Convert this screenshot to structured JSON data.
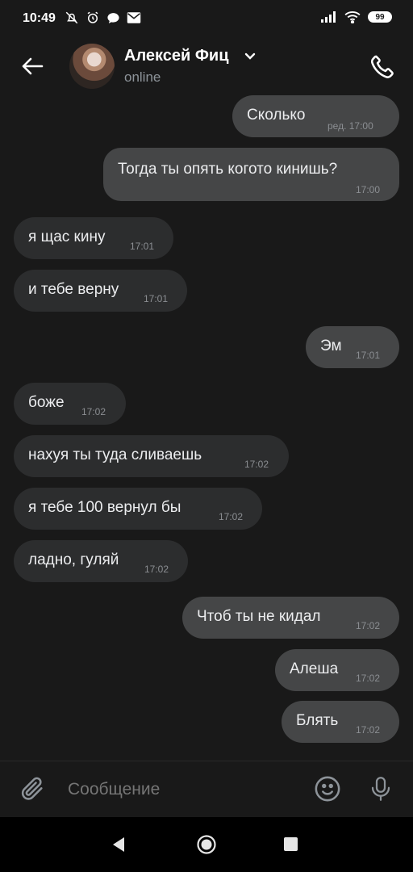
{
  "status": {
    "time": "10:49",
    "battery": "99"
  },
  "header": {
    "name": "Алексей Фиц",
    "status": "online"
  },
  "messages": [
    {
      "text": "Сколько",
      "time": "ред. 17:00",
      "dir": "out"
    },
    {
      "text": "Тогда ты опять когото кинишь?",
      "time": "17:00",
      "dir": "out"
    },
    {
      "text": "я щас кину",
      "time": "17:01",
      "dir": "in"
    },
    {
      "text": "и тебе верну",
      "time": "17:01",
      "dir": "in"
    },
    {
      "text": "Эм",
      "time": "17:01",
      "dir": "out"
    },
    {
      "text": "боже",
      "time": "17:02",
      "dir": "in"
    },
    {
      "text": "нахуя ты туда сливаешь",
      "time": "17:02",
      "dir": "in"
    },
    {
      "text": "я тебе 100 вернул бы",
      "time": "17:02",
      "dir": "in"
    },
    {
      "text": "ладно, гуляй",
      "time": "17:02",
      "dir": "in"
    },
    {
      "text": "Чтоб ты не кидал",
      "time": "17:02",
      "dir": "out"
    },
    {
      "text": "Алеша",
      "time": "17:02",
      "dir": "out"
    },
    {
      "text": "Блять",
      "time": "17:02",
      "dir": "out"
    }
  ],
  "composer": {
    "placeholder": "Сообщение"
  },
  "colors": {
    "background": "#191919",
    "incoming_bubble": "#2c2d2e",
    "outgoing_bubble": "#454647"
  }
}
